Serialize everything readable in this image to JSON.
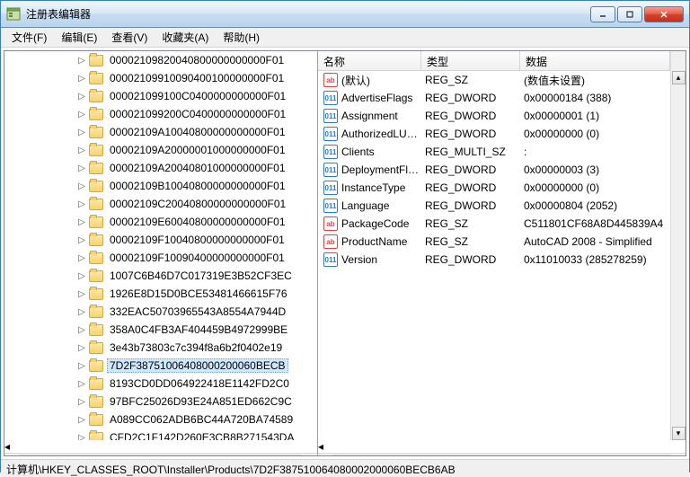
{
  "window": {
    "title": "注册表编辑器"
  },
  "menu": {
    "file": "文件(F)",
    "edit": "编辑(E)",
    "view": "查看(V)",
    "favorites": "收藏夹(A)",
    "help": "帮助(H)"
  },
  "tree": {
    "items": [
      "00002109820040800000000000F01",
      "00002109910090400100000000F01",
      "000021099100C0400000000000F01",
      "000021099200C0400000000000F01",
      "00002109A10040800000000000F01",
      "00002109A20000001000000000F01",
      "00002109A20040801000000000F01",
      "00002109B10040800000000000F01",
      "00002109C20040800000000000F01",
      "00002109E60040800000000000F01",
      "00002109F10040800000000000F01",
      "00002109F10090400000000000F01",
      "1007C6B46D7C017319E3B52CF3EC",
      "1926E8D15D0BCE53481466615F76",
      "332EAC50703965543A8554A7944D",
      "358A0C4FB3AF404459B4972999BE",
      "3e43b73803c7c394f8a6b2f0402e19",
      "7D2F38751006408000200060BECB",
      "8193CD0DD064922418E1142FD2C0",
      "97BFC25026D93E24A851ED662C9C",
      "A089CC062ADB6BC44A720BA74589",
      "CFD2C1F142D260E3CB8B271543DA"
    ],
    "selected_index": 17
  },
  "columns": {
    "name": "名称",
    "type": "类型",
    "data": "数据"
  },
  "values": [
    {
      "icon": "sz",
      "name": "(默认)",
      "type": "REG_SZ",
      "data": "(数值未设置)"
    },
    {
      "icon": "dw",
      "name": "AdvertiseFlags",
      "type": "REG_DWORD",
      "data": "0x00000184 (388)"
    },
    {
      "icon": "dw",
      "name": "Assignment",
      "type": "REG_DWORD",
      "data": "0x00000001 (1)"
    },
    {
      "icon": "dw",
      "name": "AuthorizedLUA...",
      "type": "REG_DWORD",
      "data": "0x00000000 (0)"
    },
    {
      "icon": "dw",
      "name": "Clients",
      "type": "REG_MULTI_SZ",
      "data": ":"
    },
    {
      "icon": "dw",
      "name": "DeploymentFla...",
      "type": "REG_DWORD",
      "data": "0x00000003 (3)"
    },
    {
      "icon": "dw",
      "name": "InstanceType",
      "type": "REG_DWORD",
      "data": "0x00000000 (0)"
    },
    {
      "icon": "dw",
      "name": "Language",
      "type": "REG_DWORD",
      "data": "0x00000804 (2052)"
    },
    {
      "icon": "sz",
      "name": "PackageCode",
      "type": "REG_SZ",
      "data": "C511801CF68A8D445839A4"
    },
    {
      "icon": "sz",
      "name": "ProductName",
      "type": "REG_SZ",
      "data": "AutoCAD 2008 - Simplified"
    },
    {
      "icon": "dw",
      "name": "Version",
      "type": "REG_DWORD",
      "data": "0x11010033 (285278259)"
    }
  ],
  "statusbar": {
    "path": "计算机\\HKEY_CLASSES_ROOT\\Installer\\Products\\7D2F387510064080002000060BECB6AB"
  },
  "icons": {
    "expander": "▷"
  }
}
